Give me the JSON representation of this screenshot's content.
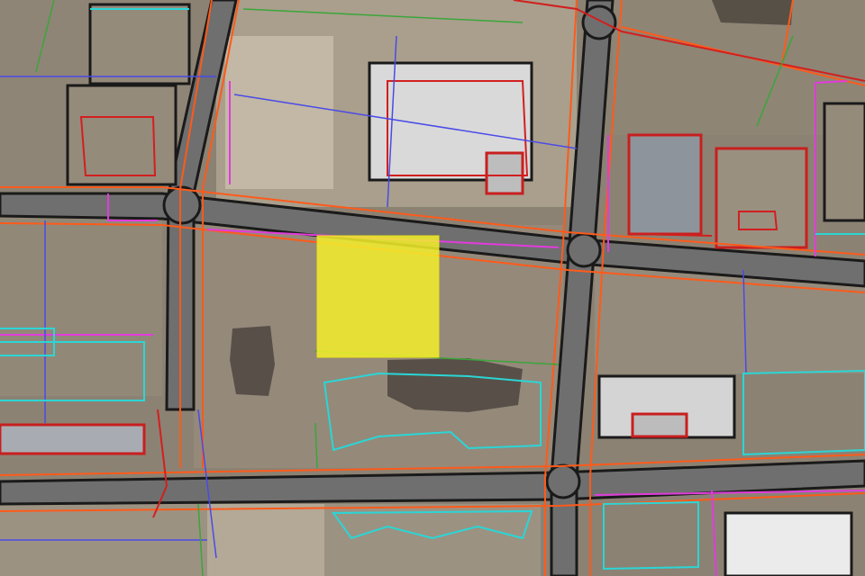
{
  "map": {
    "kind": "aerial orthophoto with cadastral / utility overlay",
    "colors": {
      "ground": "#8c8273",
      "ground_light": "#b8ad9a",
      "field": "#978b78",
      "road": "#6f6f6f",
      "road_edge": "#1a1a1a",
      "roof_white": "#d9d9d9",
      "roof_grey": "#8e949b",
      "parcel_line": "#ff5a1a",
      "property_line": "#d21f1f",
      "boundary_magenta": "#e23bdc",
      "utility_blue": "#4a4ae8",
      "utility_cyan": "#2ad6d6",
      "contour_green": "#3aa63a",
      "highlight_yellow": "#f5f02a"
    },
    "highlighted_parcel": {
      "fill": "#f5f02a",
      "opacity": 0.85
    }
  }
}
